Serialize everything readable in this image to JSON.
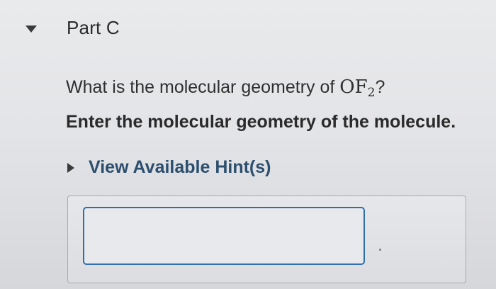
{
  "part": {
    "title": "Part C",
    "collapse_icon": "triangle-down-icon"
  },
  "question": {
    "prefix": "What is the molecular geometry of ",
    "formula_base": "OF",
    "formula_subscript": "2",
    "suffix": "?"
  },
  "instruction": "Enter the molecular geometry of the molecule.",
  "hint": {
    "label": "View Available Hint(s)",
    "icon": "triangle-right-icon"
  },
  "answer": {
    "value": ""
  },
  "colors": {
    "input_border": "#2f6fae",
    "hint_text": "#2d4f6e"
  }
}
